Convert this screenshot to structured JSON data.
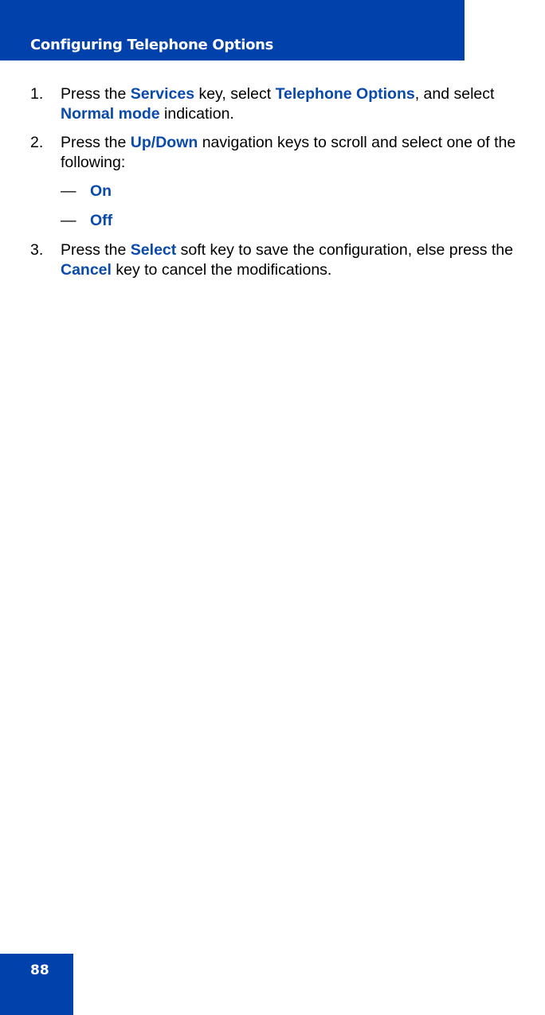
{
  "header": {
    "title": "Configuring Telephone Options"
  },
  "steps": [
    {
      "number": "1.",
      "parts": [
        {
          "text": "Press the ",
          "bold": false
        },
        {
          "text": "Services",
          "bold": true
        },
        {
          "text": " key, select ",
          "bold": false
        },
        {
          "text": "Telephone Options",
          "bold": true
        },
        {
          "text": ", and select ",
          "bold": false
        },
        {
          "text": "Normal mode",
          "bold": true
        },
        {
          "text": " indication.",
          "bold": false
        }
      ]
    },
    {
      "number": "2.",
      "parts": [
        {
          "text": "Press the ",
          "bold": false
        },
        {
          "text": "Up/Down",
          "bold": true
        },
        {
          "text": " navigation keys to scroll and select one of the following:",
          "bold": false
        }
      ]
    },
    {
      "number": "3.",
      "parts": [
        {
          "text": "Press the ",
          "bold": false
        },
        {
          "text": "Select",
          "bold": true
        },
        {
          "text": " soft key to save the configuration, else press the ",
          "bold": false
        },
        {
          "text": "Cancel",
          "bold": true
        },
        {
          "text": " key to cancel the modifications.",
          "bold": false
        }
      ]
    }
  ],
  "options": {
    "dash": "—",
    "items": [
      "On",
      "Off"
    ]
  },
  "footer": {
    "page_number": "88"
  },
  "colors": {
    "brand": "#0041ac",
    "keyword": "#0a4aac"
  }
}
